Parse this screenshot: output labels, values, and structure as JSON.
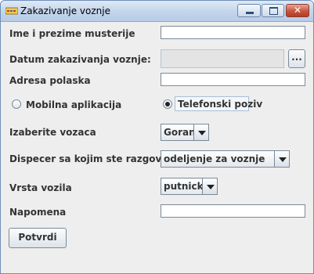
{
  "window": {
    "title": "Zakazivanje voznje"
  },
  "form": {
    "ime_label": "Ime i prezime musterije",
    "ime_value": "",
    "datum_label": "Datum zakazivanja voznje:",
    "datum_value": "",
    "datum_button": "...",
    "adresa_label": "Adresa polaska",
    "adresa_value": "",
    "radio_mobilna": {
      "label": "Mobilna aplikacija",
      "selected": false
    },
    "radio_telefon": {
      "label": "Telefonski poziv",
      "selected": true
    },
    "vozac_label": "Izaberite vozaca",
    "vozac_value": "Goran",
    "dispecer_label": "Dispecer sa kojim ste razgovarali",
    "dispecer_value": "odeljenje za voznje",
    "vozilo_label": "Vrsta vozila",
    "vozilo_value": "putnicki",
    "napomena_label": "Napomena",
    "napomena_value": "",
    "submit_label": "Potvrdi"
  }
}
